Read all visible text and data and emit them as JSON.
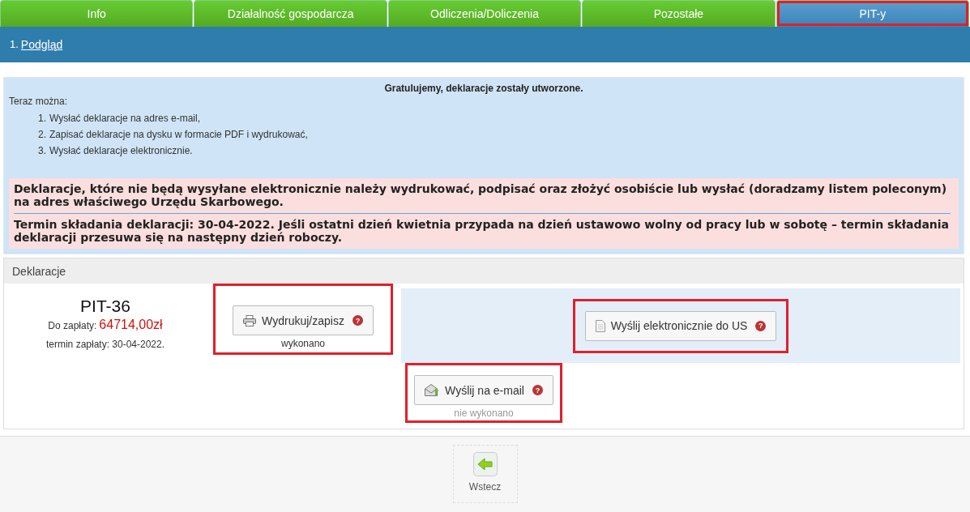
{
  "tabs": [
    {
      "label": "Info",
      "selected": false,
      "highlighted": false
    },
    {
      "label": "Działalność gospodarcza",
      "selected": false,
      "highlighted": false
    },
    {
      "label": "Odliczenia/Doliczenia",
      "selected": false,
      "highlighted": false
    },
    {
      "label": "Pozostałe",
      "selected": false,
      "highlighted": false
    },
    {
      "label": "PIT-y",
      "selected": true,
      "highlighted": true
    }
  ],
  "steps": [
    {
      "number": "1.",
      "label": "Podgląd"
    }
  ],
  "info": {
    "title": "Gratulujemy, deklaracje zostały utworzone.",
    "intro": "Teraz można:",
    "items": [
      {
        "number": "1.",
        "text": "Wysłać deklaracje na adres e-mail,"
      },
      {
        "number": "2.",
        "text": "Zapisać deklaracje na dysku w formacie PDF i wydrukować,"
      },
      {
        "number": "3.",
        "text": "Wysłać deklaracje elektronicznie."
      }
    ],
    "warnings": [
      "Deklaracje, które nie będą wysyłane elektronicznie należy wydrukować, podpisać oraz złożyć osobiście lub wysłać (doradzamy listem poleconym) na adres właściwego Urzędu Skarbowego.",
      "Termin składania deklaracji: 30-04-2022. Jeśli ostatni dzień kwietnia przypada na dzień ustawowo wolny od pracy lub w sobotę – termin składania deklaracji przesuwa się na następny dzień roboczy."
    ]
  },
  "declarations": {
    "title": "Deklaracje",
    "form": "PIT-36",
    "amount_label": "Do zapłaty:",
    "amount": "64714,00zł",
    "due": "termin zapłaty: 30-04-2022.",
    "actions": [
      {
        "kind": "print",
        "label": "Wydrukuj/zapisz",
        "help": "?",
        "status": "wykonano",
        "done": true,
        "highlighted": true
      },
      {
        "kind": "efile",
        "label": "Wyślij elektronicznie do US",
        "help": "?",
        "highlighted": true
      },
      {
        "kind": "email",
        "label": "Wyślij na e-mail",
        "help": "?",
        "status": "nie wykonano",
        "done": false,
        "highlighted": true
      }
    ]
  },
  "back": {
    "label": "Wstecz"
  }
}
